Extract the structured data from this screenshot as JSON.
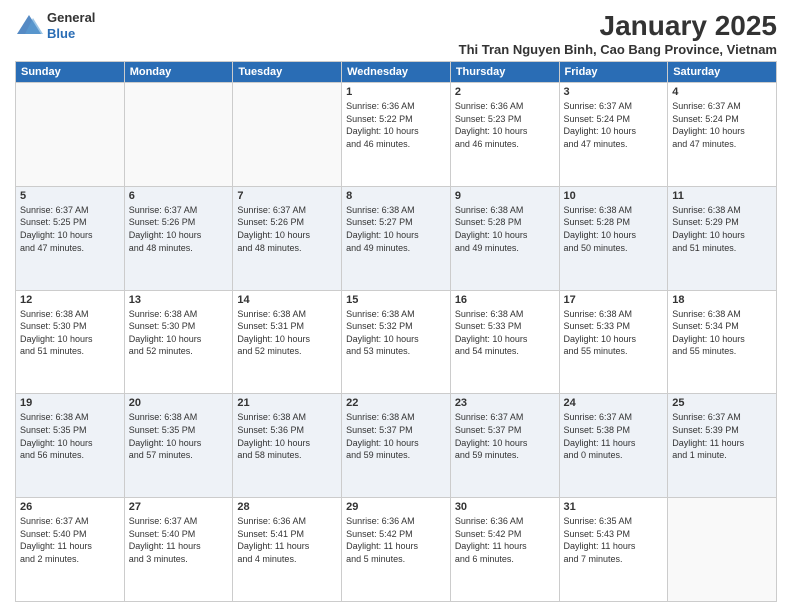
{
  "header": {
    "logo_general": "General",
    "logo_blue": "Blue",
    "month_title": "January 2025",
    "subtitle": "Thi Tran Nguyen Binh, Cao Bang Province, Vietnam"
  },
  "days_of_week": [
    "Sunday",
    "Monday",
    "Tuesday",
    "Wednesday",
    "Thursday",
    "Friday",
    "Saturday"
  ],
  "weeks": [
    [
      {
        "day": "",
        "info": ""
      },
      {
        "day": "",
        "info": ""
      },
      {
        "day": "",
        "info": ""
      },
      {
        "day": "1",
        "info": "Sunrise: 6:36 AM\nSunset: 5:22 PM\nDaylight: 10 hours\nand 46 minutes."
      },
      {
        "day": "2",
        "info": "Sunrise: 6:36 AM\nSunset: 5:23 PM\nDaylight: 10 hours\nand 46 minutes."
      },
      {
        "day": "3",
        "info": "Sunrise: 6:37 AM\nSunset: 5:24 PM\nDaylight: 10 hours\nand 47 minutes."
      },
      {
        "day": "4",
        "info": "Sunrise: 6:37 AM\nSunset: 5:24 PM\nDaylight: 10 hours\nand 47 minutes."
      }
    ],
    [
      {
        "day": "5",
        "info": "Sunrise: 6:37 AM\nSunset: 5:25 PM\nDaylight: 10 hours\nand 47 minutes."
      },
      {
        "day": "6",
        "info": "Sunrise: 6:37 AM\nSunset: 5:26 PM\nDaylight: 10 hours\nand 48 minutes."
      },
      {
        "day": "7",
        "info": "Sunrise: 6:37 AM\nSunset: 5:26 PM\nDaylight: 10 hours\nand 48 minutes."
      },
      {
        "day": "8",
        "info": "Sunrise: 6:38 AM\nSunset: 5:27 PM\nDaylight: 10 hours\nand 49 minutes."
      },
      {
        "day": "9",
        "info": "Sunrise: 6:38 AM\nSunset: 5:28 PM\nDaylight: 10 hours\nand 49 minutes."
      },
      {
        "day": "10",
        "info": "Sunrise: 6:38 AM\nSunset: 5:28 PM\nDaylight: 10 hours\nand 50 minutes."
      },
      {
        "day": "11",
        "info": "Sunrise: 6:38 AM\nSunset: 5:29 PM\nDaylight: 10 hours\nand 51 minutes."
      }
    ],
    [
      {
        "day": "12",
        "info": "Sunrise: 6:38 AM\nSunset: 5:30 PM\nDaylight: 10 hours\nand 51 minutes."
      },
      {
        "day": "13",
        "info": "Sunrise: 6:38 AM\nSunset: 5:30 PM\nDaylight: 10 hours\nand 52 minutes."
      },
      {
        "day": "14",
        "info": "Sunrise: 6:38 AM\nSunset: 5:31 PM\nDaylight: 10 hours\nand 52 minutes."
      },
      {
        "day": "15",
        "info": "Sunrise: 6:38 AM\nSunset: 5:32 PM\nDaylight: 10 hours\nand 53 minutes."
      },
      {
        "day": "16",
        "info": "Sunrise: 6:38 AM\nSunset: 5:33 PM\nDaylight: 10 hours\nand 54 minutes."
      },
      {
        "day": "17",
        "info": "Sunrise: 6:38 AM\nSunset: 5:33 PM\nDaylight: 10 hours\nand 55 minutes."
      },
      {
        "day": "18",
        "info": "Sunrise: 6:38 AM\nSunset: 5:34 PM\nDaylight: 10 hours\nand 55 minutes."
      }
    ],
    [
      {
        "day": "19",
        "info": "Sunrise: 6:38 AM\nSunset: 5:35 PM\nDaylight: 10 hours\nand 56 minutes."
      },
      {
        "day": "20",
        "info": "Sunrise: 6:38 AM\nSunset: 5:35 PM\nDaylight: 10 hours\nand 57 minutes."
      },
      {
        "day": "21",
        "info": "Sunrise: 6:38 AM\nSunset: 5:36 PM\nDaylight: 10 hours\nand 58 minutes."
      },
      {
        "day": "22",
        "info": "Sunrise: 6:38 AM\nSunset: 5:37 PM\nDaylight: 10 hours\nand 59 minutes."
      },
      {
        "day": "23",
        "info": "Sunrise: 6:37 AM\nSunset: 5:37 PM\nDaylight: 10 hours\nand 59 minutes."
      },
      {
        "day": "24",
        "info": "Sunrise: 6:37 AM\nSunset: 5:38 PM\nDaylight: 11 hours\nand 0 minutes."
      },
      {
        "day": "25",
        "info": "Sunrise: 6:37 AM\nSunset: 5:39 PM\nDaylight: 11 hours\nand 1 minute."
      }
    ],
    [
      {
        "day": "26",
        "info": "Sunrise: 6:37 AM\nSunset: 5:40 PM\nDaylight: 11 hours\nand 2 minutes."
      },
      {
        "day": "27",
        "info": "Sunrise: 6:37 AM\nSunset: 5:40 PM\nDaylight: 11 hours\nand 3 minutes."
      },
      {
        "day": "28",
        "info": "Sunrise: 6:36 AM\nSunset: 5:41 PM\nDaylight: 11 hours\nand 4 minutes."
      },
      {
        "day": "29",
        "info": "Sunrise: 6:36 AM\nSunset: 5:42 PM\nDaylight: 11 hours\nand 5 minutes."
      },
      {
        "day": "30",
        "info": "Sunrise: 6:36 AM\nSunset: 5:42 PM\nDaylight: 11 hours\nand 6 minutes."
      },
      {
        "day": "31",
        "info": "Sunrise: 6:35 AM\nSunset: 5:43 PM\nDaylight: 11 hours\nand 7 minutes."
      },
      {
        "day": "",
        "info": ""
      }
    ]
  ]
}
